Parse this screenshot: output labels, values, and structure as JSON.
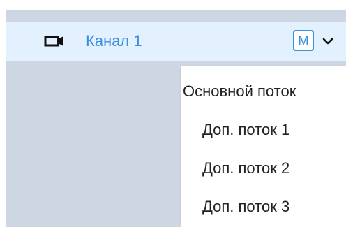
{
  "channel": {
    "icon": "video-camera-icon",
    "label": "Канал 1",
    "stream_badge": "M",
    "expand_icon": "chevron-down-icon"
  },
  "stream_menu": {
    "items": [
      {
        "label": "Основной поток"
      },
      {
        "label": "Доп. поток 1"
      },
      {
        "label": "Доп. поток 2"
      },
      {
        "label": "Доп. поток 3"
      }
    ]
  },
  "colors": {
    "accent": "#3d8de0",
    "row_highlight": "#e2f1fd",
    "panel_bg": "#cfd6e3",
    "menu_text": "#222222"
  }
}
